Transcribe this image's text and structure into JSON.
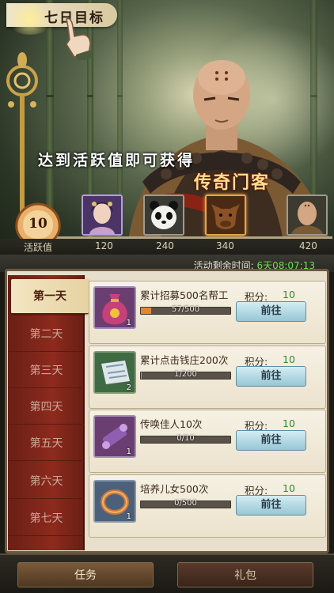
{
  "header": {
    "title": "七日目标"
  },
  "banner": {
    "promo_text": "达到活跃值即可获得",
    "promo_highlight": "传奇门客"
  },
  "activity": {
    "current": "10",
    "label": "活跃值",
    "progress": 0.024,
    "milestones": [
      {
        "value": "120",
        "reward": "lady-portrait"
      },
      {
        "value": "240",
        "reward": "panda"
      },
      {
        "value": "340",
        "reward": "ox"
      },
      {
        "value": "420",
        "reward": "monk-portrait"
      }
    ]
  },
  "timer": {
    "label": "活动剩余时间:",
    "value": "6天08:07:13"
  },
  "days": [
    "第一天",
    "第二天",
    "第三天",
    "第四天",
    "第五天",
    "第六天",
    "第七天"
  ],
  "tasks": [
    {
      "name": "累计招募500名帮工",
      "progress_text": "57/500",
      "progress": 0.114,
      "score_label": "积分:",
      "score": "10",
      "button": "前往",
      "icon": "money-bag-icon",
      "icon_count": "1"
    },
    {
      "name": "累计点击钱庄200次",
      "progress_text": "1/200",
      "progress": 0.005,
      "score_label": "积分:",
      "score": "10",
      "button": "前往",
      "icon": "banknote-icon",
      "icon_count": "2"
    },
    {
      "name": "传唤佳人10次",
      "progress_text": "0/10",
      "progress": 0,
      "score_label": "积分:",
      "score": "10",
      "button": "前往",
      "icon": "scroll-icon",
      "icon_count": "1"
    },
    {
      "name": "培养儿女500次",
      "progress_text": "0/500",
      "progress": 0,
      "score_label": "积分:",
      "score": "10",
      "button": "前往",
      "icon": "ring-icon",
      "icon_count": "1"
    }
  ],
  "nav": {
    "task": "任务",
    "gift": "礼包"
  },
  "colors": {
    "accent_red": "#8d2a1d",
    "progress_orange": "#e8852c",
    "score_green": "#2e8a32",
    "button_blue": "#98c6d6"
  }
}
